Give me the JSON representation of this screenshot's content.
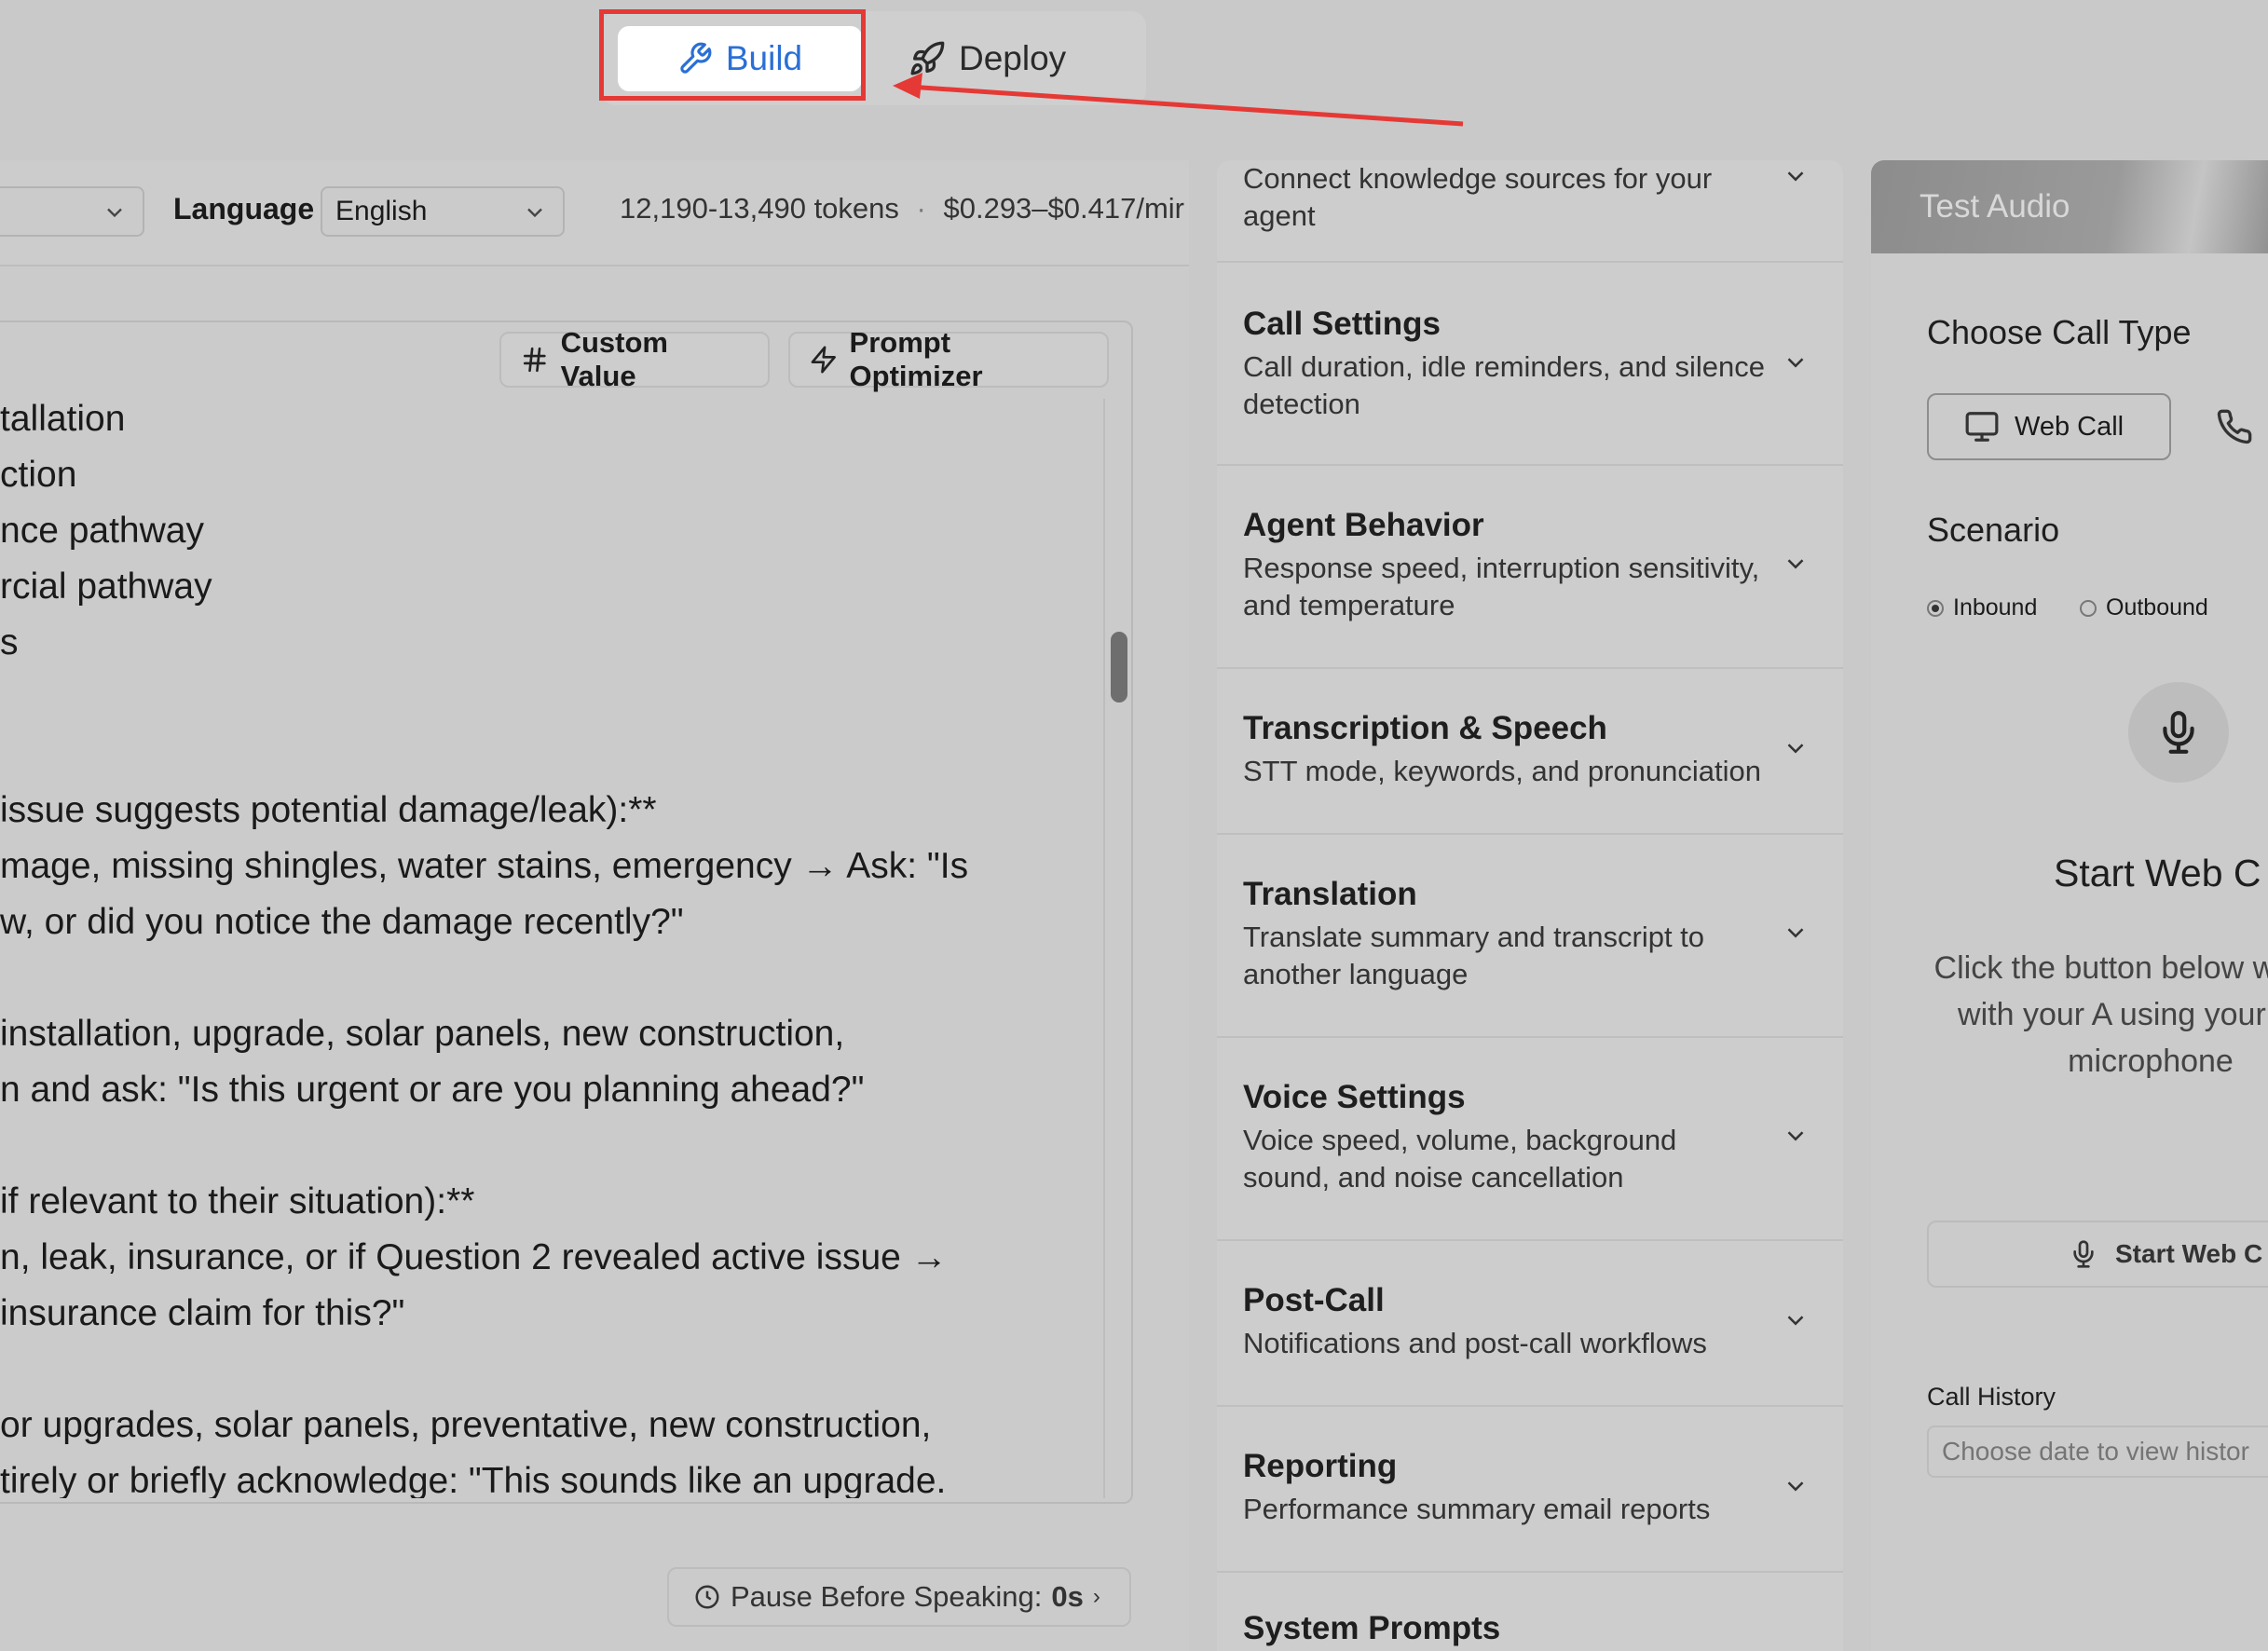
{
  "tabs": {
    "build": "Build",
    "deploy": "Deploy"
  },
  "toolbar": {
    "language_label": "Language",
    "language_value": "English",
    "tokens": "12,190-13,490 tokens",
    "separator": "·",
    "cost": "$0.293–$0.417/mir"
  },
  "editor": {
    "custom_value_label": "Custom Value",
    "prompt_optimizer_label": "Prompt Optimizer",
    "lines": [
      "tallation",
      "ction",
      "nce pathway",
      "rcial pathway",
      "s",
      "",
      "",
      " issue suggests potential damage/leak):**",
      "mage, missing shingles, water stains, emergency → Ask: \"Is",
      "w, or did you notice the damage recently?\"",
      "",
      "installation, upgrade, solar panels, new construction,",
      "n and ask: \"Is this urgent or are you planning ahead?\"",
      "",
      "if relevant to their situation):**",
      "n, leak, insurance, or if Question 2 revealed active issue →",
      "insurance claim for this?\"",
      "",
      "or upgrades, solar panels, preventative, new construction,",
      "tirely or briefly acknowledge: \"This sounds like an upgrade."
    ],
    "pause_label": "Pause Before Speaking:",
    "pause_value": "0s"
  },
  "settings": [
    {
      "title": "",
      "desc": "Connect knowledge sources for your agent"
    },
    {
      "title": "Call Settings",
      "desc": "Call duration, idle reminders, and silence detection"
    },
    {
      "title": "Agent Behavior",
      "desc": "Response speed, interruption sensitivity, and temperature"
    },
    {
      "title": "Transcription & Speech",
      "desc": "STT mode, keywords, and pronunciation"
    },
    {
      "title": "Translation",
      "desc": "Translate summary and transcript to another language"
    },
    {
      "title": "Voice Settings",
      "desc": "Voice speed, volume, background sound, and noise cancellation"
    },
    {
      "title": "Post-Call",
      "desc": "Notifications and post-call workflows"
    },
    {
      "title": "Reporting",
      "desc": "Performance summary email reports"
    },
    {
      "title": "System Prompts",
      "desc": ""
    }
  ],
  "test_audio": {
    "title": "Test Audio",
    "call_type_label": "Choose Call Type",
    "web_call": "Web Call",
    "scenario_label": "Scenario",
    "inbound": "Inbound",
    "outbound": "Outbound",
    "start_title": "Start Web C",
    "help_text": "Click the button below web call with your A using your brow microphone",
    "start_button": "Start Web C",
    "history_label": "Call History",
    "history_placeholder": "Choose date to view histor"
  }
}
